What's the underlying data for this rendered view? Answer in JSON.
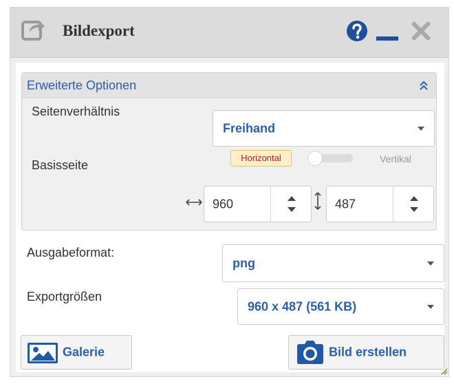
{
  "window": {
    "title": "Bildexport",
    "icons": {
      "title": "share-icon",
      "help": "help-icon",
      "minimize": "minimize-icon",
      "close": "close-icon"
    }
  },
  "advanced": {
    "header": "Erweiterte Optionen",
    "aspect_label": "Seitenverhältnis",
    "aspect_value": "Freihand",
    "base_label": "Basisseite",
    "base_horizontal": "Horizontal",
    "base_vertical": "Vertikal",
    "base_toggle_on": false,
    "width": "960",
    "height": "487"
  },
  "output": {
    "format_label": "Ausgabeformat:",
    "format_value": "png",
    "size_label": "Exportgrößen",
    "size_value": "960 x 487 (561 KB)"
  },
  "buttons": {
    "gallery": "Galerie",
    "create": "Bild erstellen"
  },
  "colors": {
    "accent": "#2b5eab",
    "badge_text": "#b02020",
    "badge_bg": "#fff0c8"
  }
}
